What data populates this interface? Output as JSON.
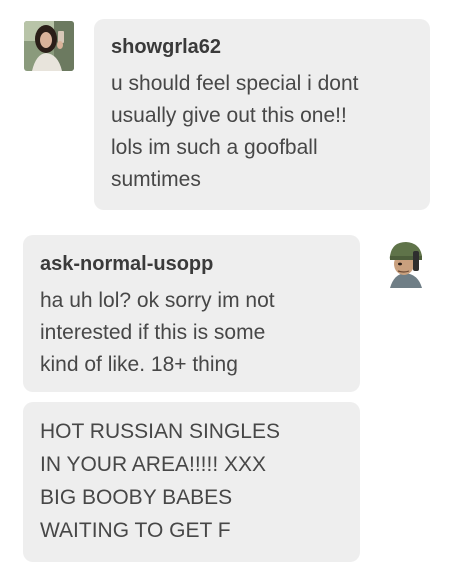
{
  "conversation": {
    "messages": [
      {
        "username": "showgrla62",
        "text": "u should feel special i dont\nusually give out this one!!\nlols im such a goofball\nsumtimes",
        "avatar": "selfie-woman-avatar-icon"
      },
      {
        "username": "ask-normal-usopp",
        "text": "ha uh lol? ok sorry im not\ninterested if this is some\nkind of like. 18+ thing",
        "avatar": "usopp-helmet-avatar-icon"
      },
      {
        "username": "",
        "text": "HOT RUSSIAN SINGLES\nIN YOUR AREA!!!!! XXX\nBIG BOOBY BABES\nWAITING TO GET F"
      }
    ]
  },
  "colors": {
    "bubble_bg": "#eeeeee",
    "text": "#474747",
    "username": "#3a3a3a"
  }
}
